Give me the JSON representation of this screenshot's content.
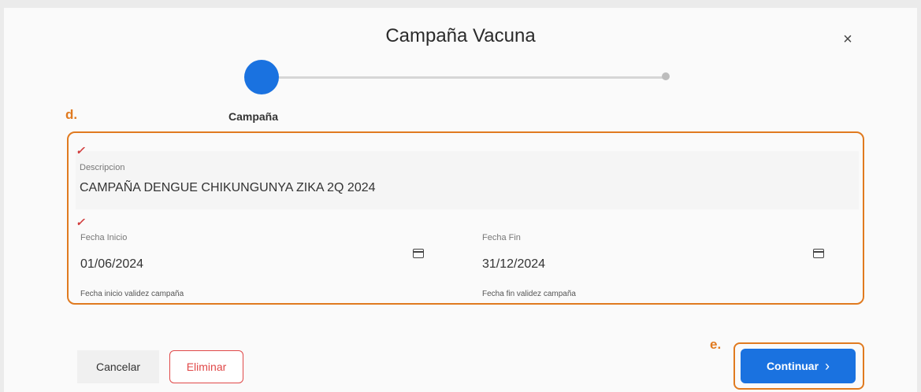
{
  "dialog": {
    "title": "Campaña Vacuna",
    "close_glyph": "×",
    "close_icon": "close-icon"
  },
  "stepper": {
    "active_step_label": "Campaña"
  },
  "annotations": {
    "form_marker": "d.",
    "continue_marker": "e."
  },
  "form": {
    "required_marker": "✓",
    "description": {
      "label": "Descripcion",
      "value": "CAMPAÑA DENGUE CHIKUNGUNYA ZIKA 2Q 2024"
    },
    "start_date": {
      "label": "Fecha Inicio",
      "value": "01/06/2024",
      "hint": "Fecha inicio validez campaña",
      "icon": "calendar-icon"
    },
    "end_date": {
      "label": "Fecha Fin",
      "value": "31/12/2024",
      "hint": "Fecha fin validez campaña",
      "icon": "calendar-icon"
    }
  },
  "footer": {
    "cancel_label": "Cancelar",
    "delete_label": "Eliminar",
    "continue_label": "Continuar",
    "continue_icon": "chevron-right-icon"
  },
  "colors": {
    "primary": "#1a72e0",
    "annotation_orange": "#e07a1f",
    "danger": "#e04848"
  }
}
